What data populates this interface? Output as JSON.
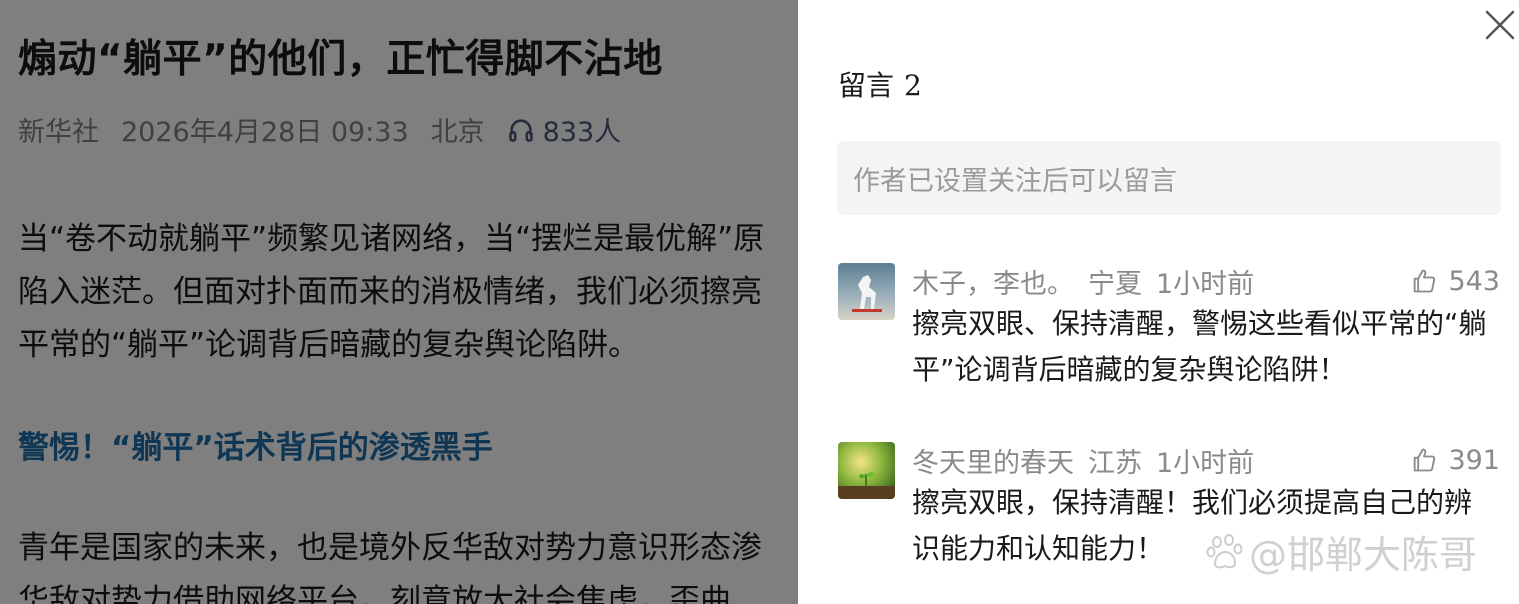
{
  "article": {
    "title": "煽动“躺平”的他们，正忙得脚不沾地",
    "source": "新华社",
    "datetime": "2026年4月28日 09:33",
    "location": "北京",
    "listeners": "833人",
    "paragraph1": [
      "当“卷不动就躺平”频繁见诸网络，当“摆烂是最优解”原",
      "陷入迷茫。但面对扑面而来的消极情绪，我们必须擦亮",
      "平常的“躺平”论调背后暗藏的复杂舆论陷阱。"
    ],
    "subheading": "警惕！“躺平”话术背后的渗透黑手",
    "paragraph2": [
      "青年是国家的未来，也是境外反华敌对势力意识形态渗",
      "华敌对势力借助网络平台，刻意放大社会焦虑，歪曲"
    ]
  },
  "panel": {
    "title": "留言",
    "count": "2",
    "input_placeholder": "作者已设置关注后可以留言",
    "comments": [
      {
        "user": "木子，李也。",
        "region": "宁夏",
        "time": "1小时前",
        "likes": "543",
        "text": [
          "擦亮双眼、保持清醒，警惕这些看似平常的“躺",
          "平”论调背后暗藏的复杂舆论陷阱！"
        ]
      },
      {
        "user": "冬天里的春天",
        "region": "江苏",
        "time": "1小时前",
        "likes": "391",
        "text": [
          "擦亮双眼，保持清醒！我们必须提高自己的辨",
          "识能力和认知能力！"
        ]
      }
    ]
  },
  "watermark": "@邯郸大陈哥",
  "colors": {
    "overlay": "rgba(0,0,0,0.5)",
    "subheading": "#1f6fa8",
    "input_bg": "#f4f4f4",
    "muted_text": "#8a8a8a"
  },
  "icons": [
    "headphones-icon",
    "close-icon",
    "thumbs-up-icon"
  ]
}
